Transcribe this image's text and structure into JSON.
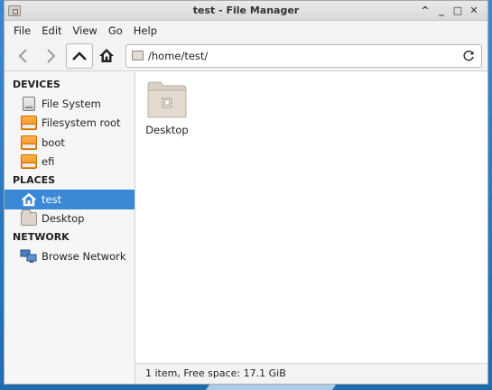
{
  "window": {
    "title": "test - File Manager",
    "controls": {
      "maximize": "^",
      "minimize": "_",
      "restore": "□",
      "close": "✕"
    }
  },
  "menubar": {
    "items": [
      "File",
      "Edit",
      "View",
      "Go",
      "Help"
    ]
  },
  "toolbar": {
    "back_icon": "back-arrow-icon",
    "forward_icon": "forward-arrow-icon",
    "up_icon": "up-arrow-icon",
    "home_icon": "home-icon",
    "location_path": "/home/test/",
    "reload_icon": "reload-icon"
  },
  "sidebar": {
    "devices_heading": "DEVICES",
    "devices": [
      {
        "label": "File System",
        "icon": "hard-drive-icon"
      },
      {
        "label": "Filesystem root",
        "icon": "orange-drive-icon"
      },
      {
        "label": "boot",
        "icon": "orange-drive-icon"
      },
      {
        "label": "efi",
        "icon": "orange-drive-icon"
      }
    ],
    "places_heading": "PLACES",
    "places": [
      {
        "label": "test",
        "icon": "home-icon",
        "selected": true
      },
      {
        "label": "Desktop",
        "icon": "folder-icon",
        "selected": false
      }
    ],
    "network_heading": "NETWORK",
    "network": [
      {
        "label": "Browse Network",
        "icon": "network-icon"
      }
    ]
  },
  "content": {
    "items": [
      {
        "name": "Desktop",
        "icon": "folder-icon"
      }
    ]
  },
  "statusbar": {
    "text": "1 item, Free space: 17.1 GiB"
  },
  "colors": {
    "selection": "#3a88d6",
    "desktop": "#2d7fc0"
  }
}
